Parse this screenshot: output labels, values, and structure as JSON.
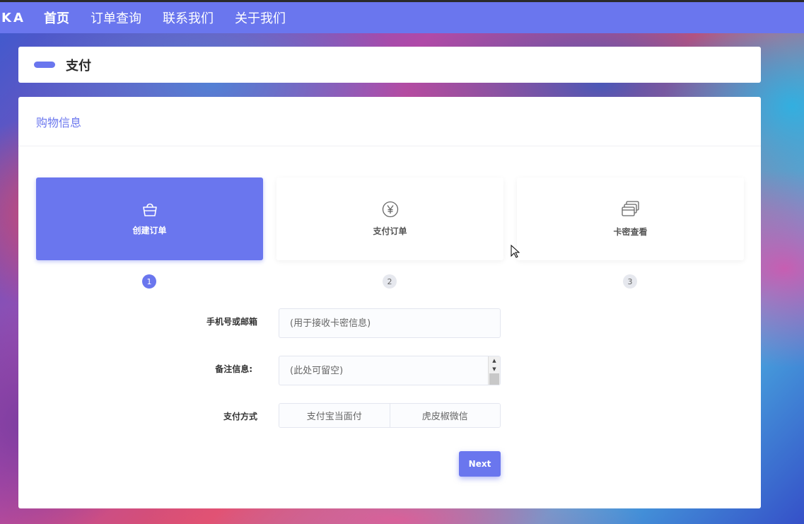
{
  "nav": {
    "brand": "KA",
    "items": [
      {
        "label": "首页"
      },
      {
        "label": "订单查询"
      },
      {
        "label": "联系我们"
      },
      {
        "label": "关于我们"
      }
    ]
  },
  "page": {
    "title": "支付"
  },
  "section": {
    "heading": "购物信息"
  },
  "steps": [
    {
      "label": "创建订单",
      "num": "1",
      "icon": "shopping-bag-icon"
    },
    {
      "label": "支付订单",
      "num": "2",
      "icon": "yen-circle-icon"
    },
    {
      "label": "卡密查看",
      "num": "3",
      "icon": "cards-icon"
    }
  ],
  "form": {
    "contact_label": "手机号或邮箱",
    "contact_placeholder": "(用于接收卡密信息)",
    "note_label": "备注信息:",
    "note_placeholder": "(此处可留空)",
    "payment_label": "支付方式",
    "payment_options": [
      {
        "label": "支付宝当面付"
      },
      {
        "label": "虎皮椒微信"
      }
    ],
    "next_label": "Next"
  },
  "colors": {
    "accent": "#6a76ee"
  }
}
